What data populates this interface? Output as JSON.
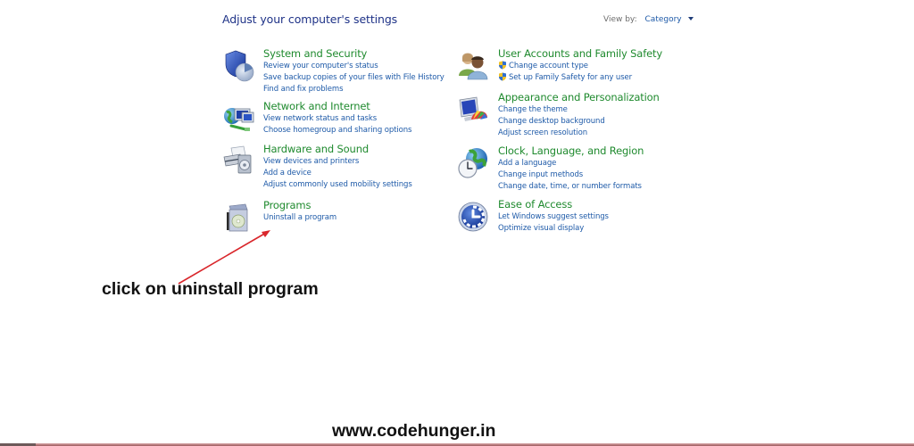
{
  "header": {
    "title": "Adjust your computer's settings",
    "view_by_label": "View by:",
    "view_by_value": "Category"
  },
  "categories": [
    {
      "title": "System and Security",
      "icon": "shield-icon",
      "links": [
        "Review your computer's status",
        "Save backup copies of your files with File History",
        "Find and fix problems"
      ]
    },
    {
      "title": "Network and Internet",
      "icon": "network-globe-icon",
      "links": [
        "View network status and tasks",
        "Choose homegroup and sharing options"
      ]
    },
    {
      "title": "Hardware and Sound",
      "icon": "printer-speaker-icon",
      "links": [
        "View devices and printers",
        "Add a device",
        "Adjust commonly used mobility settings"
      ]
    },
    {
      "title": "Programs",
      "icon": "programs-box-icon",
      "links": [
        "Uninstall a program"
      ]
    },
    {
      "title": "User Accounts and Family Safety",
      "icon": "users-icon",
      "links": [
        "Change account type",
        "Set up Family Safety for any user"
      ],
      "link_icon": "uac-shield-icon"
    },
    {
      "title": "Appearance and Personalization",
      "icon": "monitor-palette-icon",
      "links": [
        "Change the theme",
        "Change desktop background",
        "Adjust screen resolution"
      ]
    },
    {
      "title": "Clock, Language, and Region",
      "icon": "globe-clock-icon",
      "links": [
        "Add a language",
        "Change input methods",
        "Change date, time, or number formats"
      ]
    },
    {
      "title": "Ease of Access",
      "icon": "ease-of-access-icon",
      "links": [
        "Let Windows suggest settings",
        "Optimize visual display"
      ]
    }
  ],
  "annotation": {
    "text": "click on uninstall program",
    "arrow_color": "#d9262b"
  },
  "watermark": "www.codehunger.in",
  "colors": {
    "category_title": "#1f8a2e",
    "link": "#1e5aa8",
    "heading": "#1e3287"
  }
}
